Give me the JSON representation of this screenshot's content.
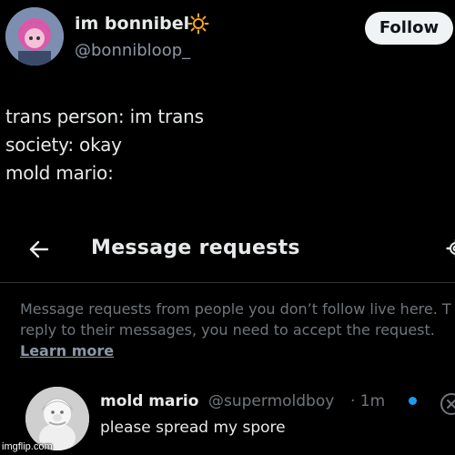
{
  "tweet": {
    "display_name": "im bonnibel",
    "handle": "@bonnibloop_",
    "follow_label": "Follow",
    "lines": [
      "trans person: im trans",
      "society: okay",
      "mold mario:"
    ]
  },
  "message_requests": {
    "title": "Message requests",
    "info_lines": [
      "Message requests from people you don’t follow live here. T",
      "reply to their messages, you need to accept the request."
    ],
    "learn_more_label": "Learn more",
    "request": {
      "name": "mold mario",
      "handle": "@supermoldboy",
      "time": "· 1m",
      "message": "please spread my spore"
    }
  },
  "watermark": "imgflip.com",
  "colors": {
    "background": "#000000",
    "primary_text": "#e7e9ea",
    "secondary_text": "#71767b",
    "unread_dot": "#1d9bf0",
    "follow_button_bg": "#eff3f4"
  },
  "icons": [
    "sun-icon",
    "back-arrow-icon",
    "gear-icon",
    "close-icon"
  ]
}
